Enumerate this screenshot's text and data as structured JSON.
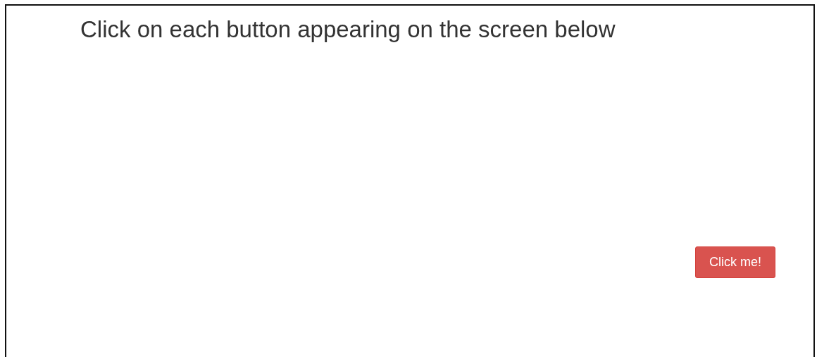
{
  "heading": "Click on each button appearing on the screen below",
  "button": {
    "label": "Click me!"
  }
}
